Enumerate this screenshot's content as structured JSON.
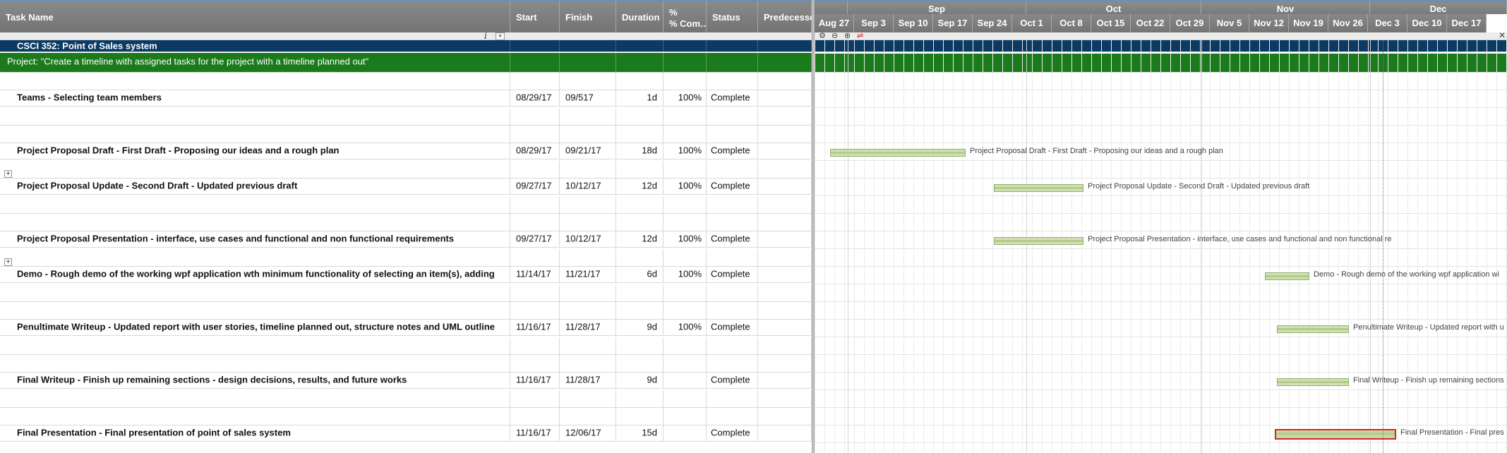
{
  "grid": {
    "columns": {
      "task_name": "Task Name",
      "start": "Start",
      "finish": "Finish",
      "duration": "Duration",
      "percent_complete": "% Com…",
      "percent_prefix": "%",
      "status": "Status",
      "predecessors": "Predecesso"
    },
    "info_glyph": "i",
    "dropdown_glyph": "▾",
    "expand_glyph": "+",
    "project_title": "CSCI 352: Point of Sales system",
    "project_description": "Project: \"Create a timeline with assigned tasks for the project with a timeline planned out\"",
    "tasks": [
      {
        "name": "Teams - Selecting team members",
        "start": "08/29/17",
        "finish": "09/517",
        "duration": "1d",
        "percent": "100%",
        "status": "Complete"
      },
      {
        "name": "Project Proposal Draft - First Draft - Proposing our ideas and a rough plan",
        "start": "08/29/17",
        "finish": "09/21/17",
        "duration": "18d",
        "percent": "100%",
        "status": "Complete"
      },
      {
        "name": "Project Proposal Update - Second Draft - Updated previous draft",
        "start": "09/27/17",
        "finish": "10/12/17",
        "duration": "12d",
        "percent": "100%",
        "status": "Complete"
      },
      {
        "name": "Project Proposal Presentation - interface, use cases and functional and non functional requirements",
        "start": "09/27/17",
        "finish": "10/12/17",
        "duration": "12d",
        "percent": "100%",
        "status": "Complete"
      },
      {
        "name": "Demo - Rough demo of the working wpf application wth minimum functionality of selecting an item(s), adding",
        "start": "11/14/17",
        "finish": "11/21/17",
        "duration": "6d",
        "percent": "100%",
        "status": "Complete"
      },
      {
        "name": "Penultimate Writeup - Updated report with user stories, timeline planned out, structure notes and UML outline",
        "start": "11/16/17",
        "finish": "11/28/17",
        "duration": "9d",
        "percent": "100%",
        "status": "Complete"
      },
      {
        "name": "Final Writeup - Finish up remaining sections - design decisions, results, and future works",
        "start": "11/16/17",
        "finish": "11/28/17",
        "duration": "9d",
        "percent": "",
        "status": "Complete"
      },
      {
        "name": "Final Presentation - Final presentation of point of sales system",
        "start": "11/16/17",
        "finish": "12/06/17",
        "duration": "15d",
        "percent": "",
        "status": "Complete"
      }
    ]
  },
  "gantt": {
    "months": [
      "Sep",
      "Oct",
      "Nov",
      "Dec"
    ],
    "weeks": [
      "Aug 27",
      "Sep 3",
      "Sep 10",
      "Sep 17",
      "Sep 24",
      "Oct 1",
      "Oct 8",
      "Oct 15",
      "Oct 22",
      "Oct 29",
      "Nov 5",
      "Nov 12",
      "Nov 19",
      "Nov 26",
      "Dec 3",
      "Dec 10",
      "Dec 17"
    ],
    "tools": {
      "settings": "⚙",
      "zoom_out": "⊖",
      "zoom_in": "⊕",
      "critical_path": "⇌",
      "close": "✕"
    },
    "bar_labels": [
      "Project Proposal Draft - First Draft - Proposing our ideas and a rough plan",
      "Project Proposal Update - Second Draft - Updated previous draft",
      "Project Proposal Presentation - interface, use cases and functional and non functional re",
      "Demo - Rough demo of the working wpf application wi",
      "Penultimate Writeup - Updated report with u",
      "Final Writeup - Finish up remaining sections",
      "Final Presentation - Final pres"
    ]
  },
  "colors": {
    "project_row": "#0b3a63",
    "description_row": "#1b7a1b",
    "bar_fill": "#cfe0b3",
    "selected_bar_border": "#dd2222"
  }
}
